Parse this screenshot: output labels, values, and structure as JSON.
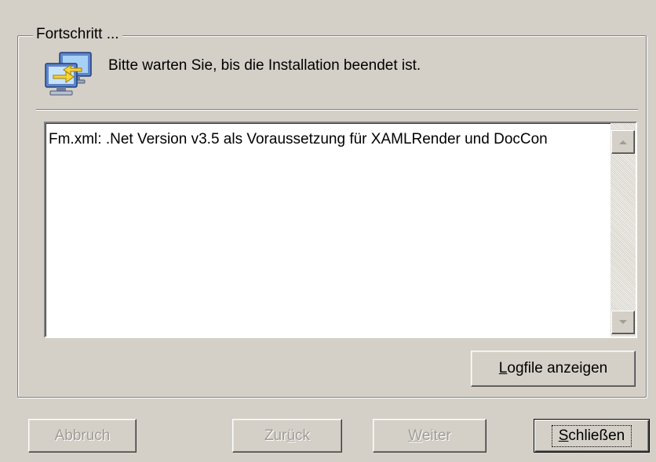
{
  "group": {
    "title": "Fortschritt ..."
  },
  "status": {
    "message": "Bitte warten Sie, bis die Installation beendet ist.",
    "icon": "install-monitors-icon"
  },
  "log": {
    "lines": [
      "Fm.xml: .Net Version v3.5 als Voraussetzung für XAMLRender und DocCon"
    ]
  },
  "buttons": {
    "logfile": {
      "mnemonic": "L",
      "rest": "ogfile anzeigen"
    },
    "cancel": {
      "label": "Abbruch"
    },
    "back": {
      "pre": "Zur",
      "mnemonic": "ü",
      "post": "ck"
    },
    "next": {
      "mnemonic": "W",
      "rest": "eiter"
    },
    "close": {
      "mnemonic": "S",
      "rest": "chließen"
    }
  },
  "colors": {
    "face": "#d4d0c8",
    "disabled_text": "#a09d96",
    "list_background": "#ffffff"
  }
}
